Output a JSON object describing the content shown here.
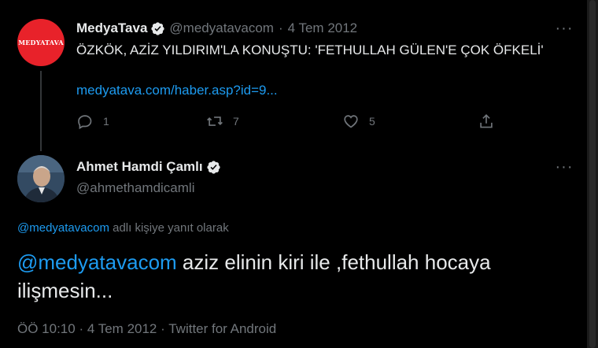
{
  "parent_tweet": {
    "avatar_text": "MEDYATAVA",
    "name": "MedyaTava",
    "handle": "@medyatavacom",
    "separator": "·",
    "date": "4 Tem 2012",
    "text": "ÖZKÖK, AZİZ YILDIRIM'LA KONUŞTU: 'FETHULLAH GÜLEN'E ÇOK ÖFKELİ'",
    "link": "medyatava.com/haber.asp?id=9...",
    "reply_count": "1",
    "retweet_count": "7",
    "like_count": "5",
    "more_label": "···"
  },
  "main_tweet": {
    "name": "Ahmet Hamdi Çamlı",
    "handle": "@ahmethamdicamli",
    "more_label": "···",
    "reply_to_mention": "@medyatavacom",
    "reply_to_suffix": " adlı kişiye yanıt olarak",
    "body_mention": "@medyatavacom",
    "body_text": " aziz elinin kiri ile ,fethullah hocaya ilişmesin...",
    "time": "ÖÖ 10:10",
    "separator": "·",
    "date": "4 Tem 2012",
    "source": "Twitter for Android"
  },
  "icons": {
    "verified": "verified-badge-icon",
    "reply": "reply-icon",
    "retweet": "retweet-icon",
    "like": "heart-icon",
    "share": "share-icon",
    "more": "more-icon"
  },
  "colors": {
    "background": "#000000",
    "text": "#e7e9ea",
    "secondary": "#71767b",
    "link": "#1d9bf0",
    "avatar_brand": "#e8222a"
  }
}
